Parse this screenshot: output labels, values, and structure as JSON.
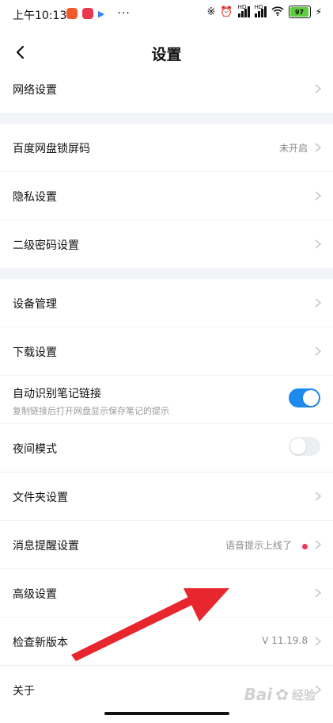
{
  "status_bar": {
    "time": "上午10:13",
    "notif_colors": [
      "#f2592b",
      "#e83a4f",
      "#3b82f6"
    ],
    "more": "···",
    "battery": "97",
    "battery_level": 0.97,
    "signal_label": "HD"
  },
  "header": {
    "title": "设置"
  },
  "groups": [
    {
      "items": [
        {
          "label": "网络设置"
        }
      ]
    },
    {
      "items": [
        {
          "label": "百度网盘锁屏码",
          "value": "未开启"
        },
        {
          "label": "隐私设置"
        },
        {
          "label": "二级密码设置"
        }
      ]
    },
    {
      "items": [
        {
          "label": "设备管理"
        },
        {
          "label": "下载设置"
        },
        {
          "label": "自动识别笔记链接",
          "sub": "复制链接后打开网盘显示保存笔记的提示",
          "toggle": true
        },
        {
          "label": "夜间模式",
          "toggle": false
        },
        {
          "label": "文件夹设置"
        },
        {
          "label": "消息提醒设置",
          "value": "语音提示上线了"
        },
        {
          "label": "高级设置"
        },
        {
          "label": "检查新版本",
          "value": "V 11.19.8"
        },
        {
          "label": "关于"
        }
      ]
    }
  ],
  "watermark": {
    "brand": "Bai",
    "cn": "经验"
  },
  "colors": {
    "accent": "#1f8aee",
    "red_dot": "#ea3a58",
    "arrow": "#e8262e"
  }
}
